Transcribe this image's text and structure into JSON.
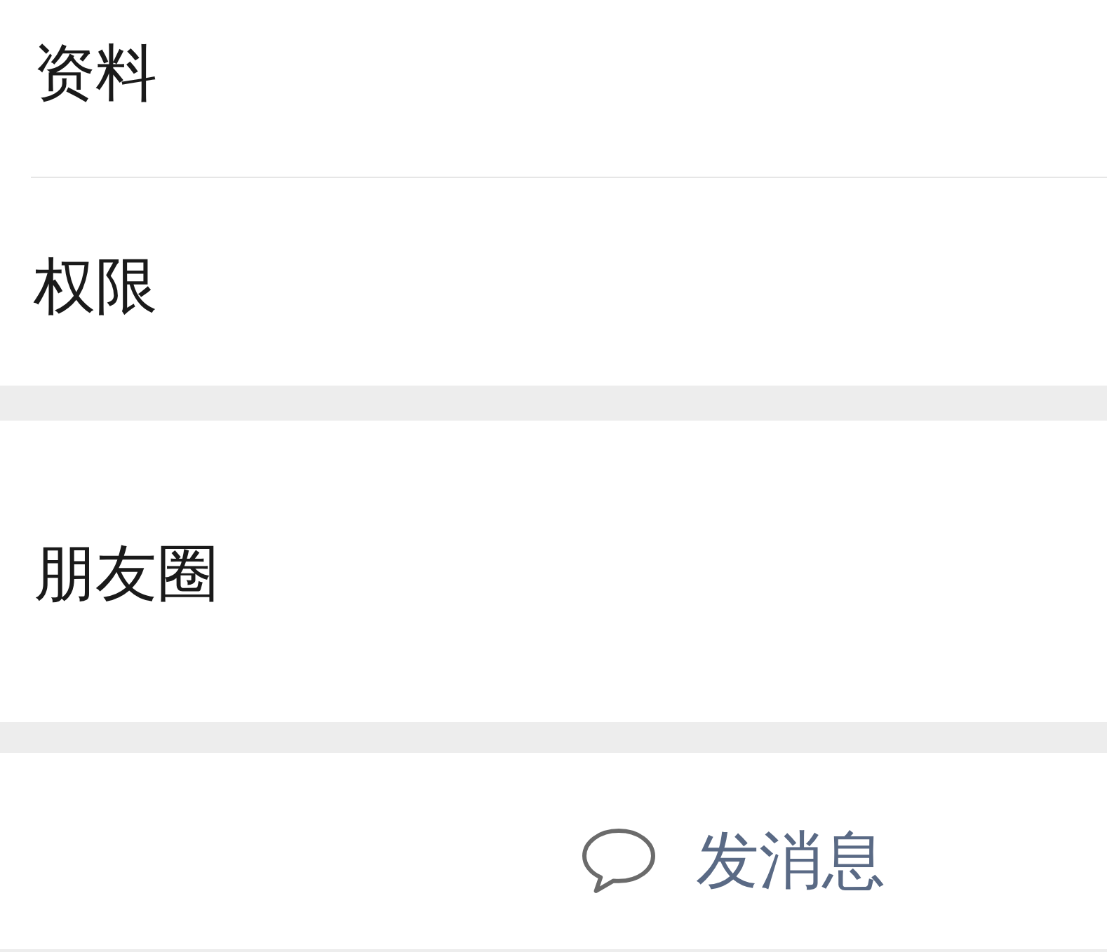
{
  "sections": [
    {
      "items": [
        {
          "label": "资料"
        },
        {
          "label": "权限"
        }
      ]
    },
    {
      "items": [
        {
          "label": "朋友圈"
        }
      ]
    }
  ],
  "action_button": {
    "label": "发消息"
  }
}
